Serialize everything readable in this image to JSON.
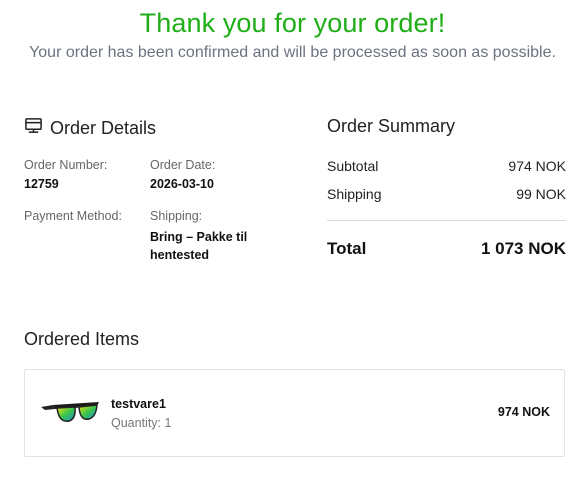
{
  "header": {
    "title": "Thank you for your order!",
    "subtitle": "Your order has been confirmed and will be processed as soon as possible."
  },
  "order_details": {
    "title": "Order Details",
    "order_number_label": "Order Number:",
    "order_number": "12759",
    "order_date_label": "Order Date:",
    "order_date": "2026-03-10",
    "payment_method_label": "Payment Method:",
    "shipping_label": "Shipping:",
    "shipping_line1": "Bring – Pakke til",
    "shipping_line2": "hentested"
  },
  "order_summary": {
    "title": "Order Summary",
    "subtotal_label": "Subtotal",
    "subtotal_value": "974 NOK",
    "shipping_label": "Shipping",
    "shipping_value": "99 NOK",
    "total_label": "Total",
    "total_value": "1 073 NOK"
  },
  "ordered_items": {
    "title": "Ordered Items",
    "items": [
      {
        "name": "testvare1",
        "quantity": "Quantity: 1",
        "price": "974 NOK",
        "image_icon": "sunglasses-icon"
      }
    ]
  },
  "colors": {
    "accent_green": "#1fae17",
    "muted_text": "#6b7280"
  }
}
